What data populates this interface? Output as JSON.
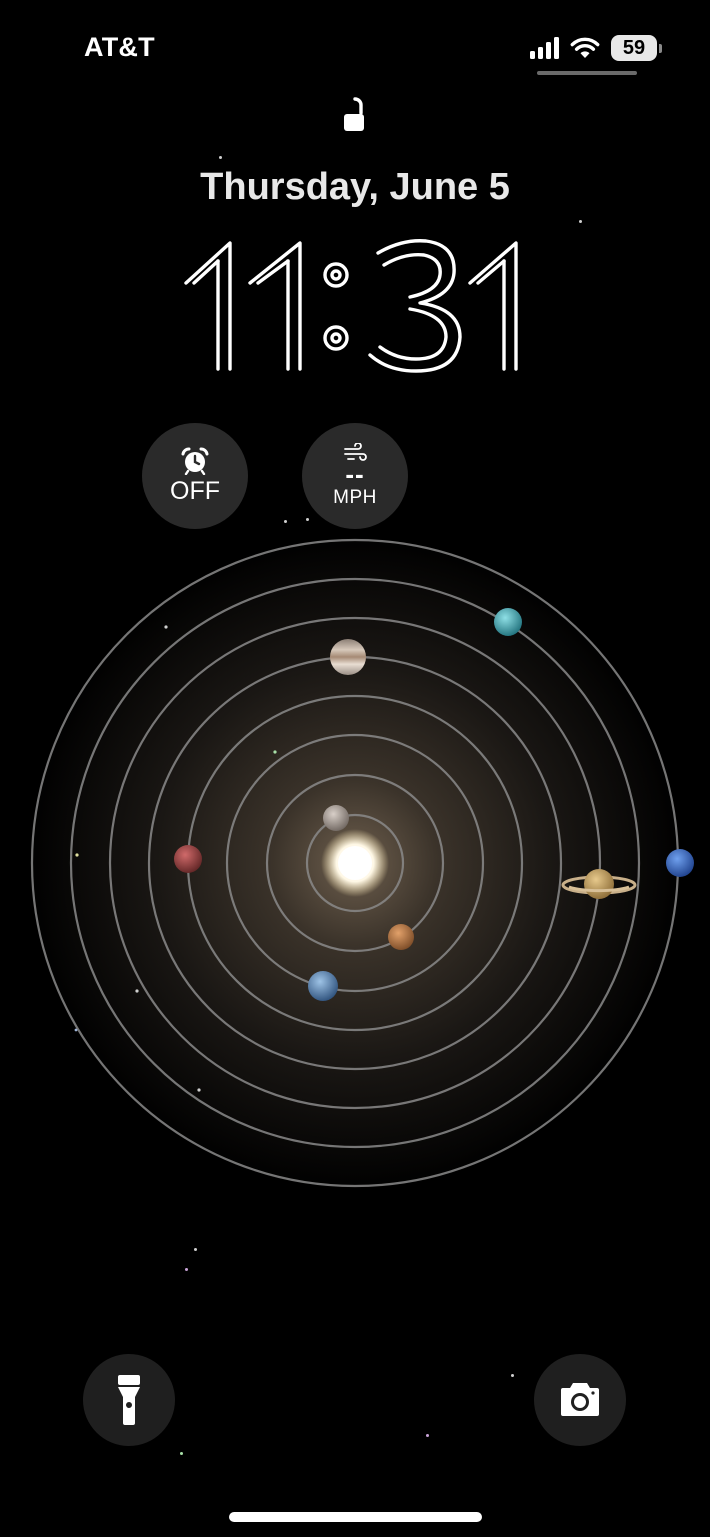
{
  "status_bar": {
    "carrier": "AT&T",
    "battery_level": "59",
    "signal_bars": 4,
    "wifi": "wifi-icon"
  },
  "lock_screen": {
    "lock_state": "unlocked",
    "date": "Thursday, June 5",
    "time": "11:31"
  },
  "widgets": {
    "alarm": {
      "icon": "alarm-clock-icon",
      "value": "OFF"
    },
    "wind": {
      "icon": "wind-icon",
      "value": "--",
      "unit": "MPH"
    }
  },
  "wallpaper": {
    "type": "solar-system-astronomy",
    "planets": [
      "Mercury",
      "Venus",
      "Earth",
      "Mars",
      "Jupiter",
      "Saturn",
      "Uranus",
      "Neptune"
    ]
  },
  "bottom_controls": {
    "left": "flashlight-icon",
    "right": "camera-icon"
  },
  "colors": {
    "background": "#000000",
    "widget_bg": "#2a2a2a",
    "orbit": "#8a8a8a"
  }
}
